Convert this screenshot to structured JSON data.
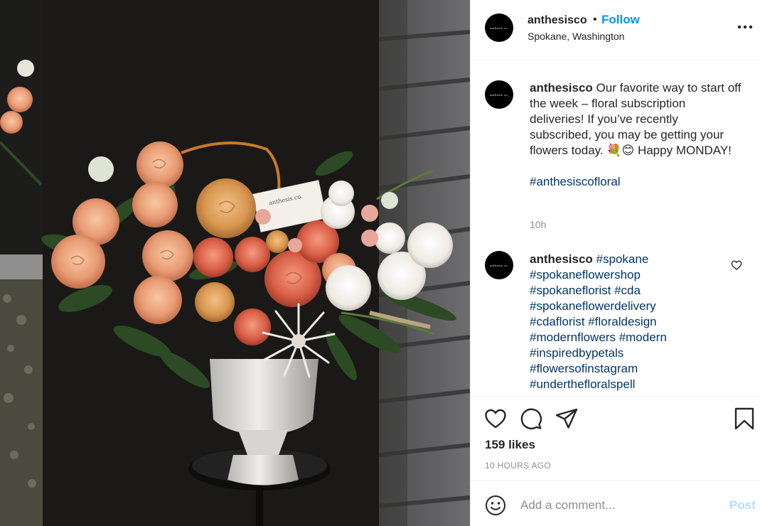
{
  "post": {
    "photo_alt": "",
    "card_text": "anthesis co."
  },
  "header": {
    "avatar_text": "anthesis co.",
    "username": "anthesisco",
    "separator": "•",
    "follow_label": "Follow",
    "location": "Spokane, Washington",
    "more_icon": "more-horizontal-icon"
  },
  "caption": {
    "avatar_text": "anthesis co.",
    "username": "anthesisco",
    "text": "Our favorite way to start off the week – floral subscription deliveries! If you’ve recently subscribed, you may be getting your flowers today. 💐😊 Happy MONDAY!",
    "hashtag": "#anthesiscofloral",
    "time": "10h"
  },
  "comment": {
    "avatar_text": "anthesis co.",
    "username": "anthesisco",
    "tags": [
      "#spokane",
      "#spokaneflowershop",
      "#spokaneflorist",
      "#cda",
      "#spokaneflowerdelivery",
      "#cdaflorist",
      "#floraldesign",
      "#modernflowers",
      "#modern",
      "#inspiredbypetals",
      "#flowersofinstagram",
      "#underthefloralspell"
    ]
  },
  "actions": {
    "like_icon": "heart-icon",
    "comment_icon": "comment-icon",
    "share_icon": "share-icon",
    "save_icon": "bookmark-icon"
  },
  "likes": "159 likes",
  "posted_ago": "10 HOURS AGO",
  "add_comment": {
    "emoji_icon": "emoji-icon",
    "placeholder": "Add a comment...",
    "post_label": "Post"
  },
  "colors": {
    "link_blue": "#0095f6",
    "hashtag": "#00376b",
    "muted": "#8e8e8e",
    "post_disabled": "#b2dffc"
  }
}
